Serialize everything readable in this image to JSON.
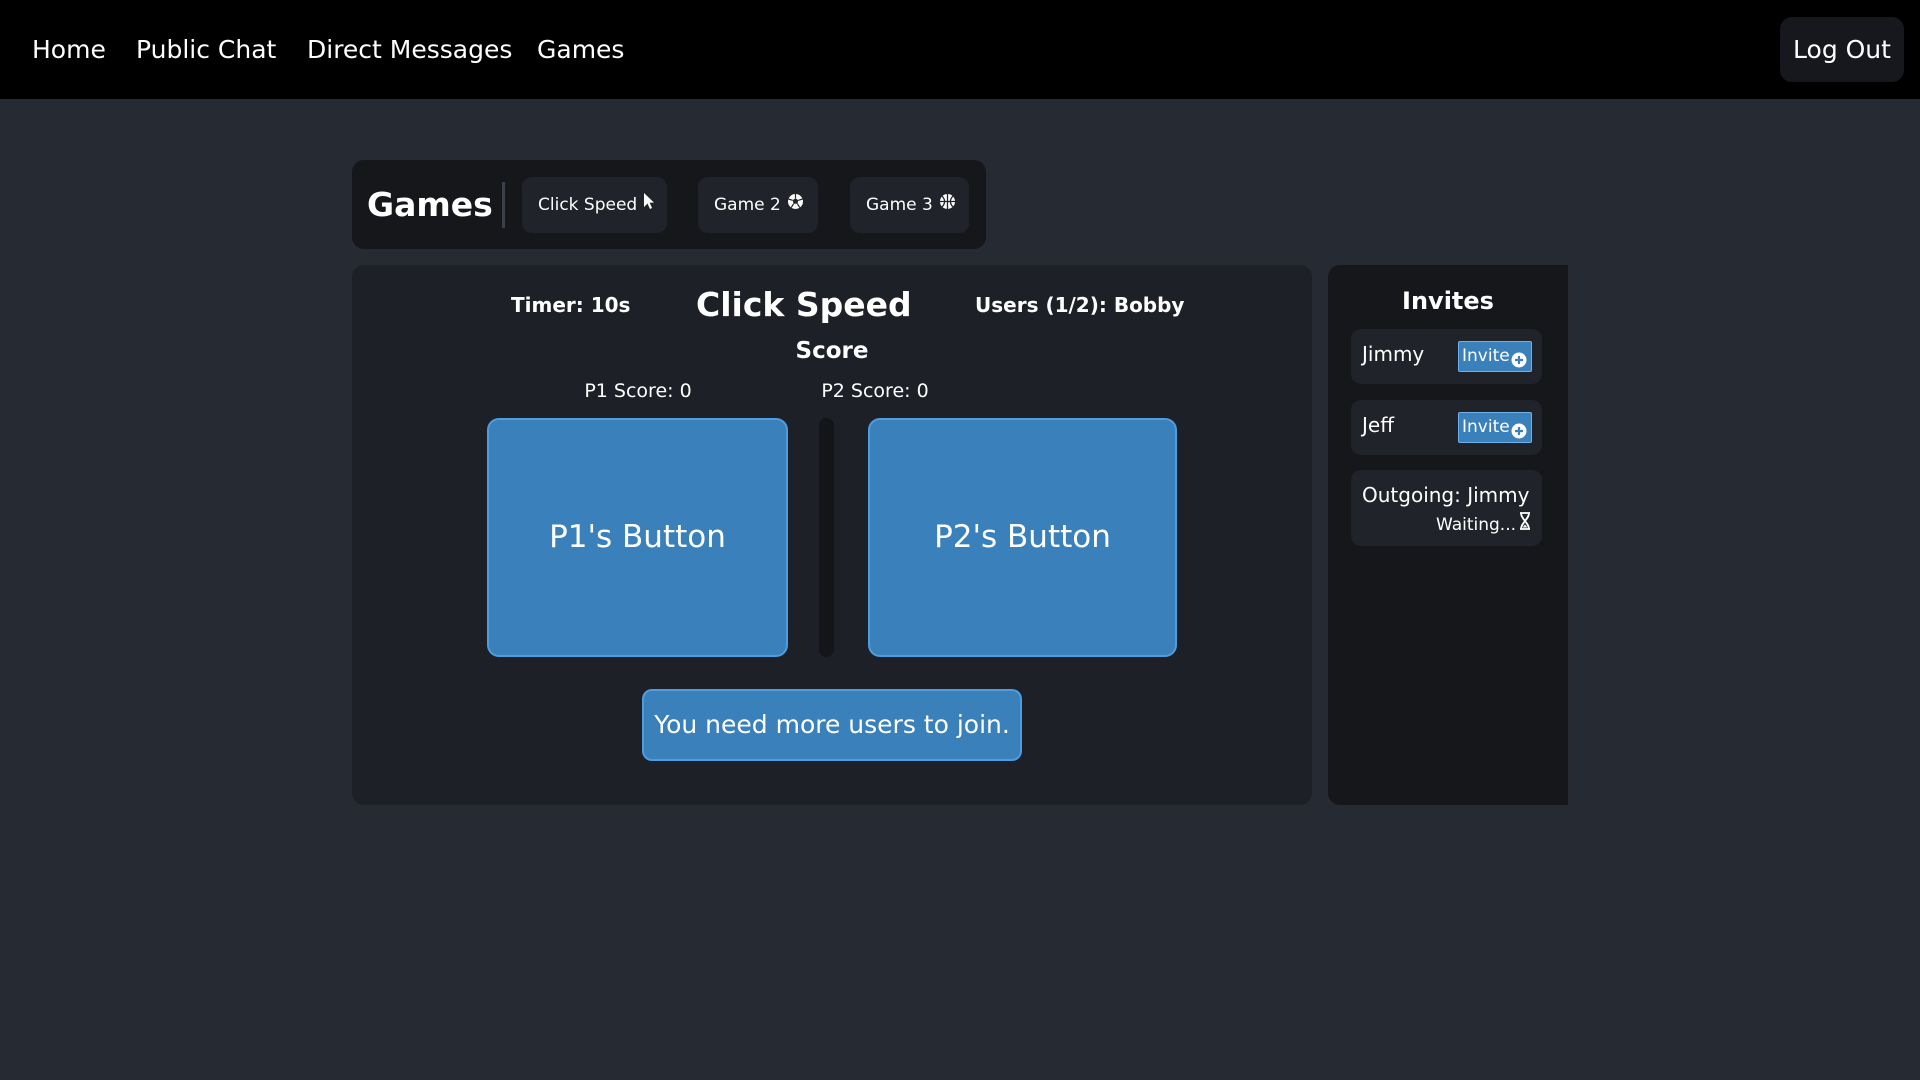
{
  "nav": {
    "links": [
      "Home",
      "Public Chat",
      "Direct Messages",
      "Games"
    ],
    "logout_label": "Log Out"
  },
  "games_bar": {
    "title": "Games",
    "tabs": [
      {
        "label": "Click Speed",
        "icon": "cursor-icon"
      },
      {
        "label": "Game 2",
        "icon": "soccer-ball-icon"
      },
      {
        "label": "Game 3",
        "icon": "basketball-icon"
      }
    ]
  },
  "game": {
    "timer": "Timer: 10s",
    "title": "Click Speed",
    "users": "Users (1/2): Bobby",
    "score_heading": "Score",
    "p1_score": "P1 Score: 0",
    "p2_score": "P2 Score: 0",
    "p1_button": "P1's Button",
    "p2_button": "P2's Button",
    "status": "You need more users to join."
  },
  "invites": {
    "title": "Invites",
    "users": [
      {
        "name": "Jimmy",
        "button": "Invite"
      },
      {
        "name": "Jeff",
        "button": "Invite"
      }
    ],
    "outgoing": "Outgoing: Jimmy",
    "waiting": "Waiting..."
  },
  "colors": {
    "background": "#262a33",
    "nav": "#000000",
    "accent": "#3a80bb",
    "panel": "#1d2026"
  }
}
